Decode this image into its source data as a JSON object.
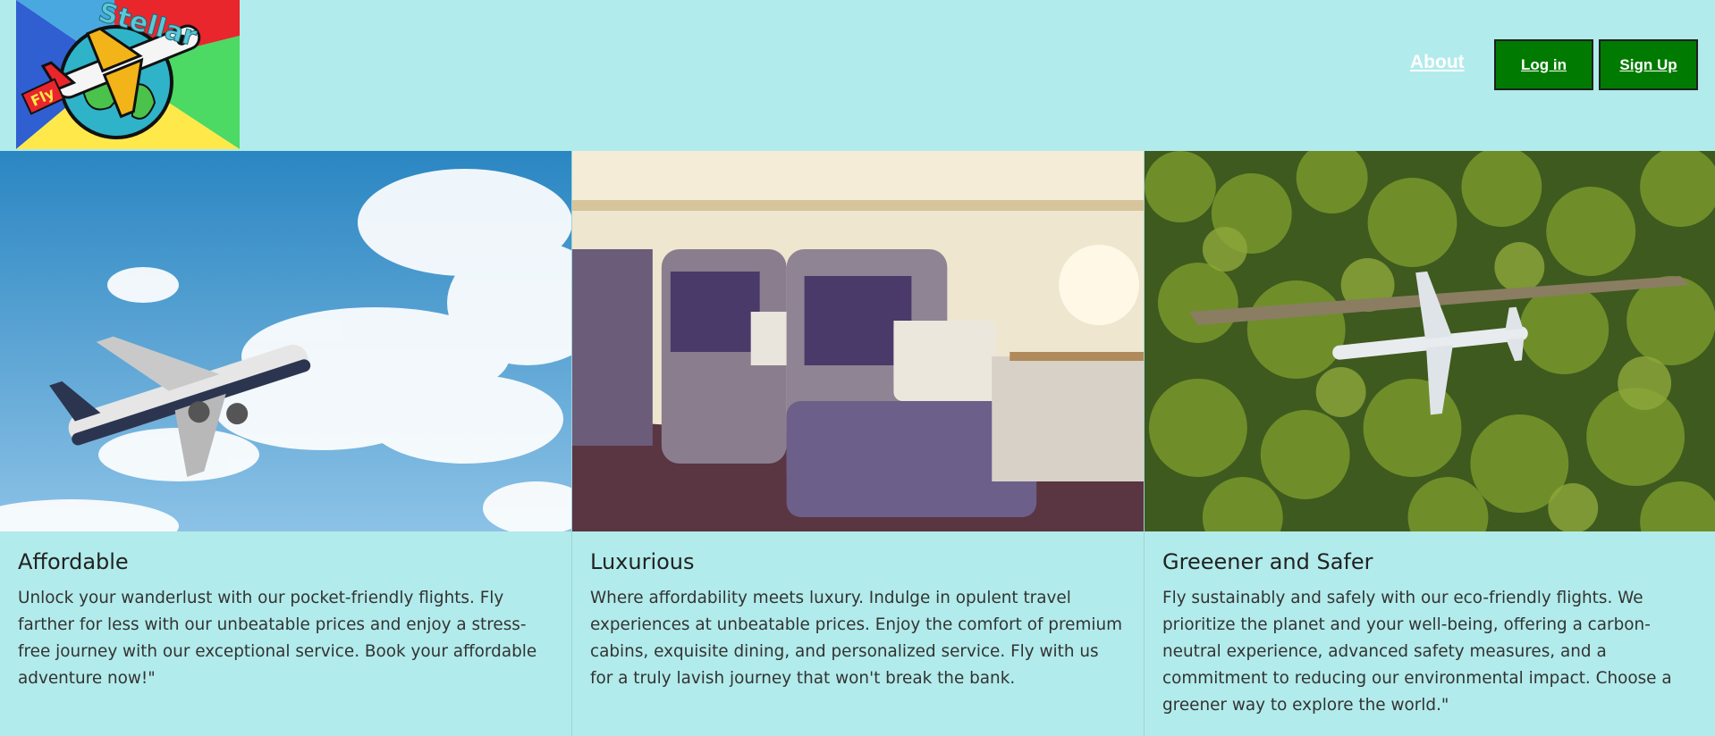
{
  "header": {
    "logo_text": "Stellar",
    "logo_badge": "Fly",
    "nav_about": "About",
    "login_label": "Log in",
    "signup_label": "Sign Up"
  },
  "colors": {
    "page_background": "#b2ebeb",
    "button_background": "#007a00",
    "button_text": "#ffffff"
  },
  "cards": [
    {
      "image": "airplane-in-sky-photo",
      "title": "Affordable",
      "text": "Unlock your wanderlust with our pocket-friendly flights. Fly farther for less with our unbeatable prices and enjoy a stress-free journey with our exceptional service. Book your affordable adventure now!\""
    },
    {
      "image": "luxury-cabin-seats-photo",
      "title": "Luxurious",
      "text": "Where affordability meets luxury. Indulge in opulent travel experiences at unbeatable prices. Enjoy the comfort of premium cabins, exquisite dining, and personalized service. Fly with us for a truly lavish journey that won't break the bank."
    },
    {
      "image": "plane-over-forest-photo",
      "title": "Greeener and Safer",
      "text": "Fly sustainably and safely with our eco-friendly flights. We prioritize the planet and your well-being, offering a carbon-neutral experience, advanced safety measures, and a commitment to reducing our environmental impact. Choose a greener way to explore the world.\""
    }
  ]
}
